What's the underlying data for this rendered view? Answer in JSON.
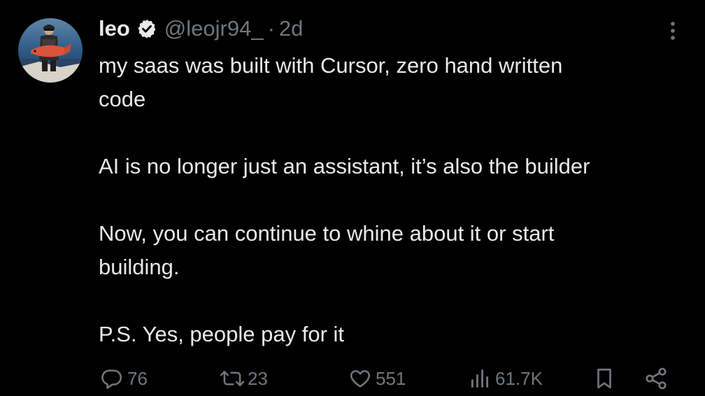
{
  "tweet": {
    "author": {
      "name": "leo",
      "handle": "@leojr94_",
      "separator": "·",
      "time": "2d",
      "verified": true
    },
    "lines": [
      "my saas was built with Cursor, zero hand written",
      "code",
      "",
      "AI is no longer just an assistant, it’s also the builder",
      "",
      "Now, you can continue to whine about it or start",
      "building.",
      "",
      "P.S. Yes, people pay for it"
    ],
    "stats": {
      "replies": "76",
      "reposts": "23",
      "likes": "551",
      "views": "61.7K"
    }
  },
  "colors": {
    "background": "#000000",
    "text": "#e7e9ea",
    "muted": "#71767b"
  },
  "icons": {
    "verified": "verified-badge-icon",
    "more": "more-options-icon",
    "reply": "reply-icon",
    "repost": "repost-icon",
    "like": "heart-icon",
    "views": "views-chart-icon",
    "bookmark": "bookmark-icon",
    "share": "share-icon"
  }
}
